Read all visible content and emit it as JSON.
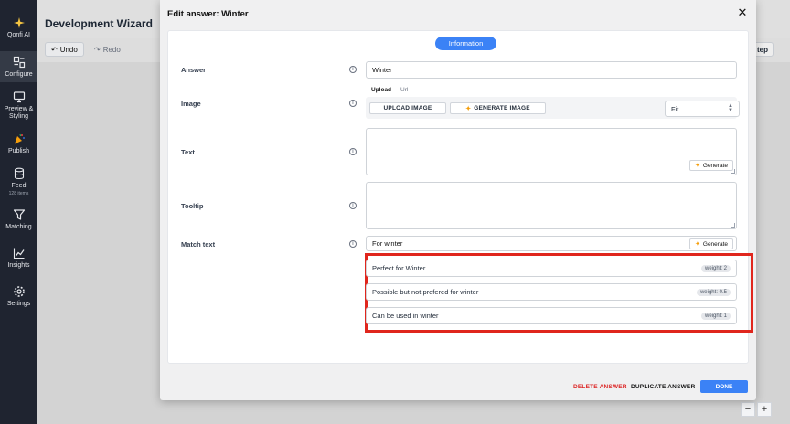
{
  "sidebar": {
    "items": [
      {
        "label": "Qonfi AI",
        "icon": "sparkle-icon"
      },
      {
        "label": "Configure",
        "icon": "configure-icon"
      },
      {
        "label": "Preview & Styling",
        "icon": "monitor-icon"
      },
      {
        "label": "Publish",
        "icon": "party-icon"
      },
      {
        "label": "Feed",
        "sub": "128 items",
        "icon": "database-icon"
      },
      {
        "label": "Matching",
        "icon": "filter-icon"
      },
      {
        "label": "Insights",
        "icon": "chart-line-icon"
      },
      {
        "label": "Settings",
        "icon": "gear-icon"
      }
    ]
  },
  "app": {
    "title": "Development Wizard",
    "undo_label": "Undo",
    "redo_label": "Redo",
    "step_label": "tep"
  },
  "modal": {
    "title": "Edit answer: Winter",
    "section_pill": "Information",
    "fields": {
      "answer": {
        "label": "Answer",
        "value": "Winter"
      },
      "image": {
        "label": "Image",
        "tabs": [
          "Upload",
          "Url"
        ],
        "upload_label": "UPLOAD IMAGE",
        "generate_label": "GENERATE IMAGE",
        "fit_value": "Fit"
      },
      "text": {
        "label": "Text",
        "generate_label": "Generate"
      },
      "tooltip": {
        "label": "Tooltip"
      },
      "match_text": {
        "label": "Match text",
        "value": "For winter",
        "generate_label": "Generate",
        "items": [
          {
            "text": "Perfect for Winter",
            "weight": "weight: 2"
          },
          {
            "text": "Possible but not prefered for winter",
            "weight": "weight: 0.5"
          },
          {
            "text": "Can be used in winter",
            "weight": "weight: 1"
          }
        ]
      }
    },
    "footer": {
      "delete_label": "DELETE ANSWER",
      "duplicate_label": "DUPLICATE ANSWER",
      "done_label": "DONE"
    }
  },
  "zoom": {
    "minus": "−",
    "plus": "+"
  },
  "colors": {
    "accent": "#3b82f6",
    "danger": "#dc2626",
    "highlight": "#e0261d",
    "sidebar": "#1f2430"
  }
}
